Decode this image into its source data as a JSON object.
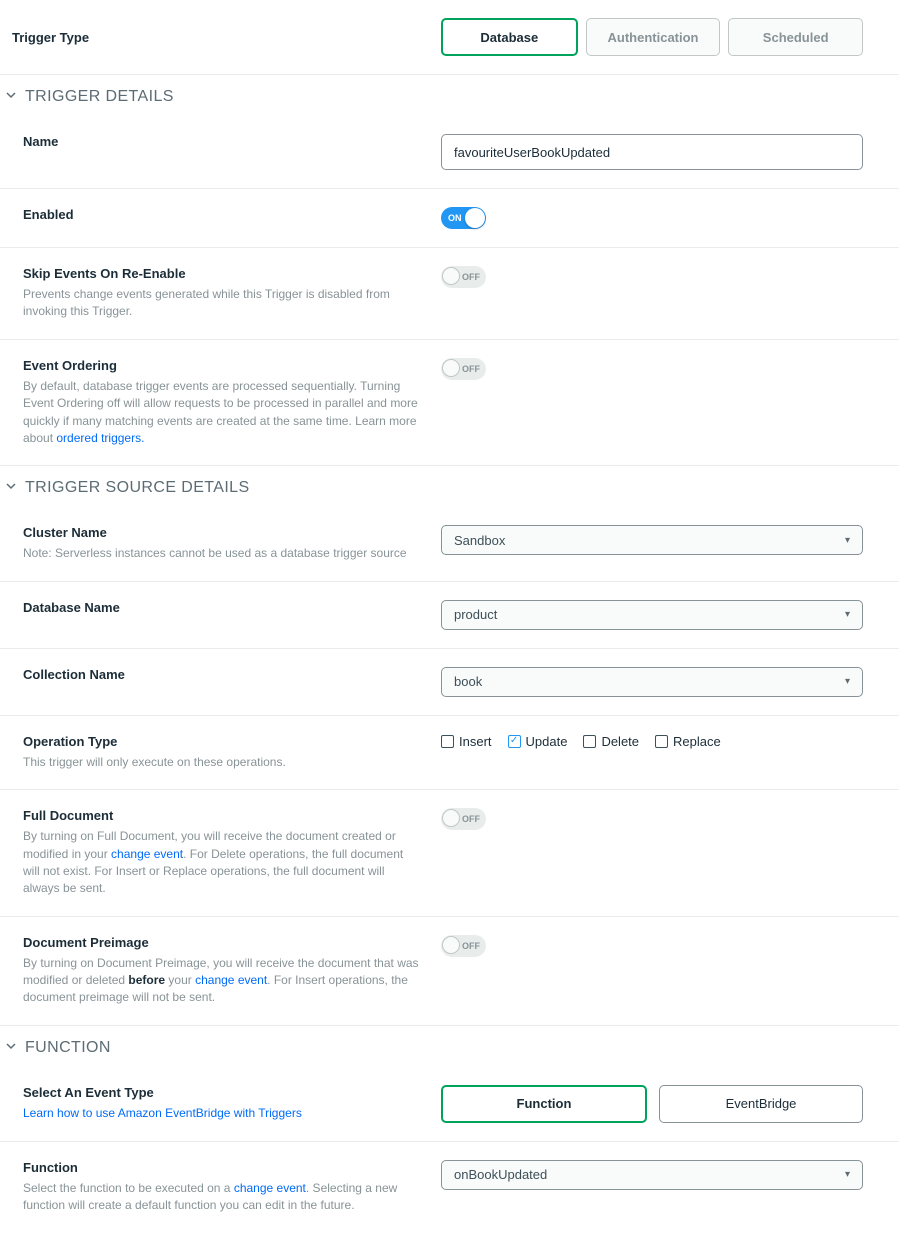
{
  "trigger_type": {
    "label": "Trigger Type",
    "options": [
      "Database",
      "Authentication",
      "Scheduled"
    ],
    "selected": "Database"
  },
  "sections": {
    "details": "TRIGGER DETAILS",
    "source": "TRIGGER SOURCE DETAILS",
    "function": "FUNCTION"
  },
  "name": {
    "label": "Name",
    "value": "favouriteUserBookUpdated"
  },
  "enabled": {
    "label": "Enabled",
    "value": true,
    "on_text": "ON"
  },
  "skip_events": {
    "label": "Skip Events On Re-Enable",
    "desc": "Prevents change events generated while this Trigger is disabled from invoking this Trigger.",
    "value": false,
    "off_text": "OFF"
  },
  "event_ordering": {
    "label": "Event Ordering",
    "desc_prefix": "By default, database trigger events are processed sequentially. Turning Event Ordering off will allow requests to be processed in parallel and more quickly if many matching events are created at the same time. Learn more about ",
    "desc_link": "ordered triggers.",
    "value": false,
    "off_text": "OFF"
  },
  "cluster": {
    "label": "Cluster Name",
    "note": "Note: Serverless instances cannot be used as a database trigger source",
    "value": "Sandbox"
  },
  "database": {
    "label": "Database Name",
    "value": "product"
  },
  "collection": {
    "label": "Collection Name",
    "value": "book"
  },
  "operation": {
    "label": "Operation Type",
    "desc": "This trigger will only execute on these operations.",
    "options": [
      "Insert",
      "Update",
      "Delete",
      "Replace"
    ],
    "checked": [
      "Update"
    ]
  },
  "full_document": {
    "label": "Full Document",
    "desc_prefix": "By turning on Full Document, you will receive the document created or modified in your ",
    "desc_link": "change event",
    "desc_suffix": ". For Delete operations, the full document will not exist. For Insert or Replace operations, the full document will always be sent.",
    "value": false,
    "off_text": "OFF"
  },
  "preimage": {
    "label": "Document Preimage",
    "desc_prefix": "By turning on Document Preimage, you will receive the document that was modified or deleted ",
    "desc_bold": "before",
    "desc_mid": " your ",
    "desc_link": "change event",
    "desc_suffix": ". For Insert operations, the document preimage will not be sent.",
    "value": false,
    "off_text": "OFF"
  },
  "event_type": {
    "label": "Select An Event Type",
    "help_link": "Learn how to use Amazon EventBridge with Triggers",
    "options": [
      "Function",
      "EventBridge"
    ],
    "selected": "Function"
  },
  "function": {
    "label": "Function",
    "desc_prefix": "Select the function to be executed on a ",
    "desc_link": "change event",
    "desc_suffix": ". Selecting a new function will create a default function you can edit in the future.",
    "value": "onBookUpdated"
  }
}
